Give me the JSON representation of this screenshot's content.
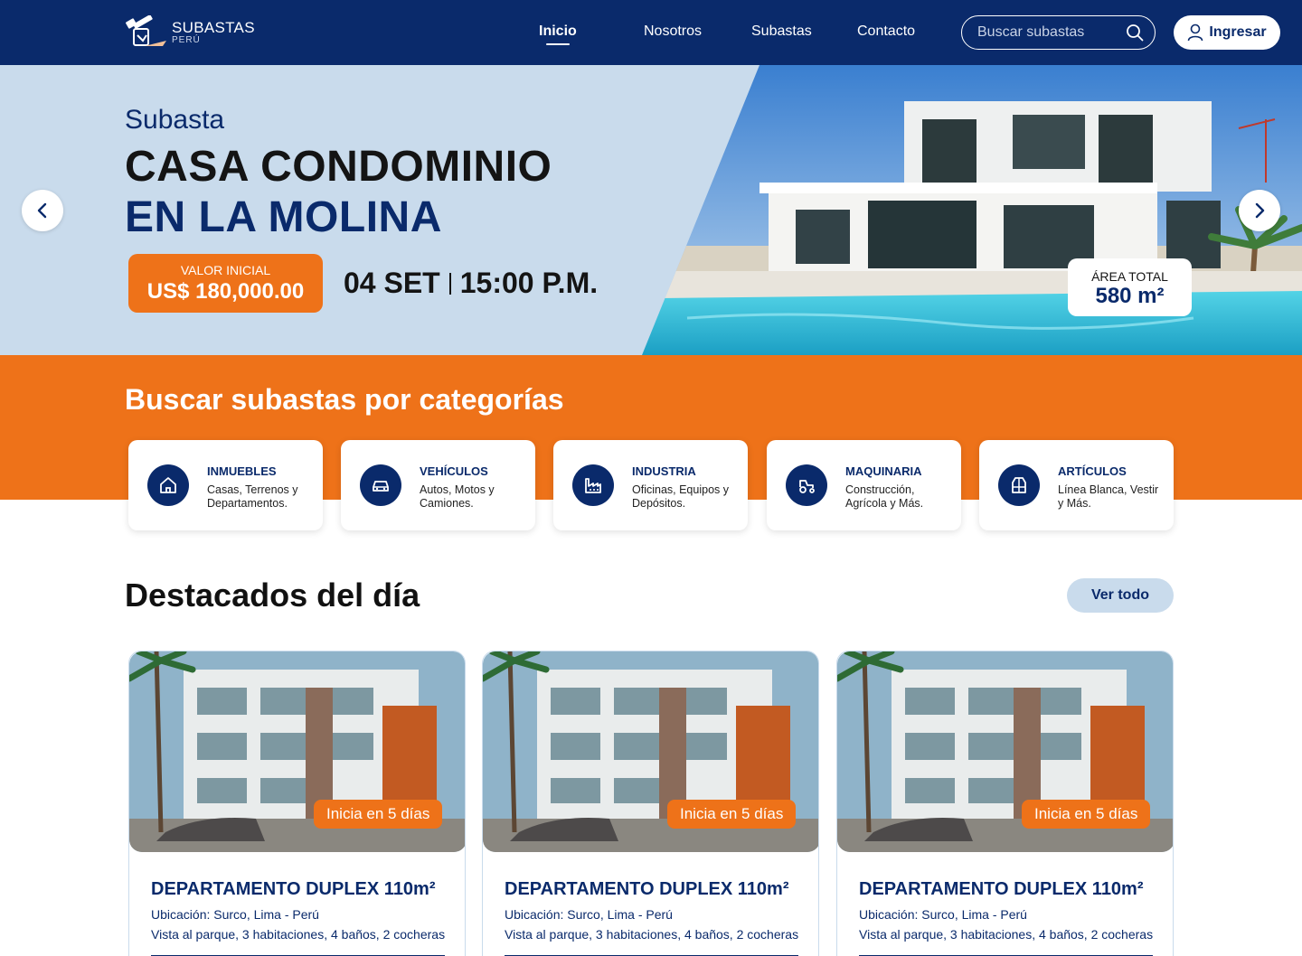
{
  "brand": {
    "name": "SUBASTAS",
    "sub": "PERÚ"
  },
  "nav": {
    "links": [
      "Inicio",
      "Nosotros",
      "Subastas",
      "Contacto"
    ],
    "active": "Inicio",
    "search_placeholder": "Buscar subastas",
    "login_label": "Ingresar"
  },
  "hero": {
    "kicker": "Subasta",
    "title_line1": "CASA CONDOMINIO",
    "title_line2": "EN LA MOLINA",
    "price_label": "VALOR INICIAL",
    "price_value": "US$ 180,000.00",
    "date": "04 SET",
    "time": "15:00 P.M.",
    "area_label": "ÁREA TOTAL",
    "area_value": "580 m²"
  },
  "categories": {
    "heading_light": "Buscar subastas",
    "heading_bold": "por categorías",
    "items": [
      {
        "title": "INMUEBLES",
        "desc": "Casas, Terrenos y Departamentos.",
        "icon": "house-icon"
      },
      {
        "title": "VEHÍCULOS",
        "desc": "Autos, Motos y Camiones.",
        "icon": "car-icon"
      },
      {
        "title": "INDUSTRIA",
        "desc": "Oficinas, Equipos y Depósitos.",
        "icon": "factory-icon"
      },
      {
        "title": "MAQUINARIA",
        "desc": "Construcción, Agrícola y Más.",
        "icon": "tractor-icon"
      },
      {
        "title": "ARTÍCULOS",
        "desc": "Línea Blanca, Vestir y Más.",
        "icon": "appliance-icon"
      }
    ]
  },
  "featured": {
    "title": "Destacados del día",
    "see_all": "Ver todo",
    "cards": [
      {
        "badge": "Inicia en 5 días",
        "title": "DEPARTAMENTO DUPLEX 110m²",
        "location": "Ubicación: Surco, Lima - Perú",
        "desc": "Vista al parque, 3 habitaciones, 4 baños, 2 cocheras"
      },
      {
        "badge": "Inicia en 5 días",
        "title": "DEPARTAMENTO DUPLEX 110m²",
        "location": "Ubicación: Surco, Lima - Perú",
        "desc": "Vista al parque, 3 habitaciones, 4 baños, 2 cocheras"
      },
      {
        "badge": "Inicia en 5 días",
        "title": "DEPARTAMENTO DUPLEX 110m²",
        "location": "Ubicación: Surco, Lima - Perú",
        "desc": "Vista al parque, 3 habitaciones, 4 baños, 2 cocheras"
      }
    ]
  },
  "colors": {
    "navy": "#0a2a6b",
    "orange": "#ee7219",
    "light_blue": "#c9dbec"
  }
}
